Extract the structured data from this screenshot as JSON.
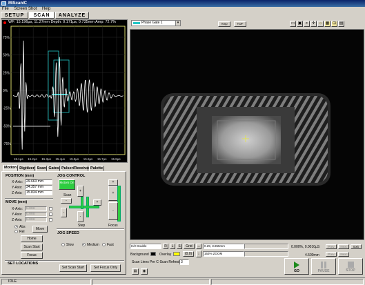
{
  "window": {
    "title": "MIScanIC"
  },
  "menu": [
    "File",
    "Screen Shot",
    "Help"
  ],
  "mode_tabs": [
    "SETUP",
    "SCAN",
    "ANALYZE"
  ],
  "ascan": {
    "status": "WF: 15.196µs, 11.27mm Depth: 0.171µs, 0.735mm Amp: 72.7%",
    "y_ticks": [
      "75%",
      "50%",
      "25%",
      "0%",
      "-25%",
      "-50%",
      "-75%"
    ],
    "x_ticks": [
      "15.1µs",
      "15.2µs",
      "15.3µs",
      "15.4µs",
      "15.5µs",
      "15.6µs",
      "15.7µs",
      "15.8µs"
    ]
  },
  "left_tabs": [
    "Motion",
    "Digitizer",
    "Scan",
    "Gates",
    "Pulser/Receiver",
    "Palette"
  ],
  "position": {
    "title": "POSITION (mm)",
    "rows": [
      {
        "label": "X-Axis:",
        "value": "29.663 mm"
      },
      {
        "label": "Y-Axis:",
        "value": "34.357 mm"
      },
      {
        "label": "Z-Axis:",
        "value": "15.834 mm"
      }
    ]
  },
  "move": {
    "title": "MOVE (mm)",
    "rows": [
      {
        "label": "X-Axis:",
        "value": "0.000"
      },
      {
        "label": "Y-Axis:",
        "value": "0.000"
      },
      {
        "label": "Z-Axis:",
        "value": "0.000"
      }
    ],
    "abs_label": "Abs",
    "rel_label": "Rel",
    "move_button": "Move",
    "home_button": "Home",
    "scan_start_button": "Scan Start",
    "focus_button": "Focus"
  },
  "jog": {
    "title": "JOG CONTROL",
    "motors_on": "Motors On",
    "scan_label": "Scan",
    "step_label": "Step",
    "focus_label": "Focus",
    "plus": "+",
    "minus": "-"
  },
  "jog_speed": {
    "title": "JOG SPEED",
    "options": [
      "Slow",
      "Medium",
      "Fast"
    ],
    "selected": "Medium"
  },
  "set_locations": {
    "title": "SET LOCATIONS",
    "set_scan_start": "Set Scan Start",
    "set_focus_only": "Set Focus Only"
  },
  "viewport_toolbar": {
    "layer": "Phase Gate 1",
    "amp_button": "Amp",
    "tof_button": "TOF",
    "tool_icons": [
      "print-icon",
      "image-icon",
      "zoom-in-icon",
      "crosshair-icon",
      "sun-icon",
      "grid-icon",
      "measure-icon",
      "palette-icon"
    ]
  },
  "controls": {
    "resolution": "H/2 Double",
    "r_button": "R",
    "l_button": "L",
    "s_button": "S",
    "grid_button": "Grid",
    "coords": "0.29, 3.855mm",
    "zoom": "163% ZOOM",
    "background_label": "Background",
    "overlay_label": "Overlay",
    "overlay_value": "(0,0)",
    "readout_1": "0.000%, 0.0010µS",
    "readout_2": "4.500mm",
    "scan_lines_label": "Scan Lines Per C-Scan Refresh",
    "scan_lines_value": "3",
    "small_buttons": [
      "Prev",
      "Next",
      "Prev",
      "Next",
      "Exit"
    ]
  },
  "big_buttons": {
    "go": "GO",
    "pause": "PAUSE",
    "stop": "STOP"
  },
  "status": {
    "state": "IDLE"
  },
  "colors": {
    "go": "#1c8a1c",
    "accent_cyan": "#21c6c6",
    "jog_green": "#2ecc40"
  }
}
